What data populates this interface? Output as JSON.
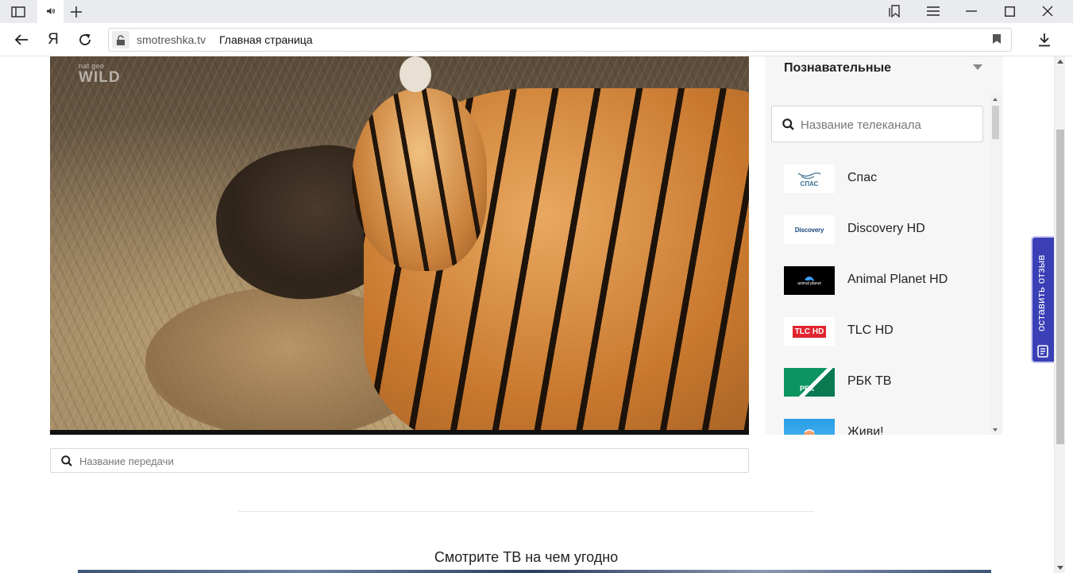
{
  "browser": {
    "tab_icon": "speaker-icon",
    "address": {
      "domain": "smotreshka.tv",
      "title": "Главная страница"
    },
    "yandex_button": "Я"
  },
  "player": {
    "watermark": "WILD",
    "watermark_small": "nat geo"
  },
  "program_search": {
    "placeholder": "Название передачи"
  },
  "sidebar": {
    "category": "Познавательные",
    "channel_search_placeholder": "Название телеканала",
    "channels": [
      {
        "name": "Спас",
        "logo_text": "СПАС",
        "logo_bg": "#ffffff",
        "logo_color": "#3a6f8f"
      },
      {
        "name": "Discovery HD",
        "logo_text": "Discovery",
        "logo_bg": "#ffffff",
        "logo_color": "#1a4a80"
      },
      {
        "name": "Animal Planet HD",
        "logo_text": "animal planet",
        "logo_bg": "#000000",
        "logo_color": "#3aa0ff"
      },
      {
        "name": "TLC HD",
        "logo_text": "TLC HD",
        "logo_bg": "#ffffff",
        "logo_color": "#e0242f"
      },
      {
        "name": "РБК ТВ",
        "logo_text": "РБК",
        "logo_bg": "#0d9463",
        "logo_color": "#ffffff"
      },
      {
        "name": "Живи!",
        "logo_text": "",
        "logo_bg": "#2a9ee6",
        "logo_color": "#ffffff"
      }
    ]
  },
  "footer": {
    "promo": "Смотрите ТВ на чем угодно"
  },
  "feedback": {
    "label": "оставить отзыв"
  }
}
